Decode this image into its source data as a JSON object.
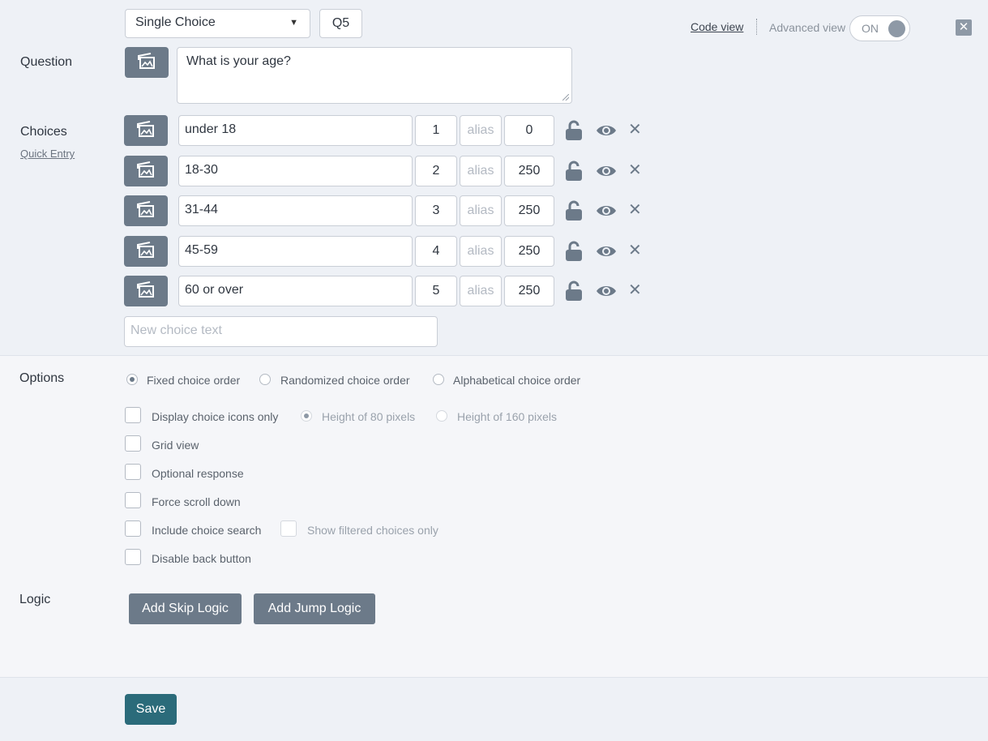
{
  "header": {
    "question_type": "Single Choice",
    "question_id": "Q5",
    "code_view_label": "Code view",
    "advanced_view_label": "Advanced view",
    "advanced_toggle": "ON"
  },
  "labels": {
    "question": "Question",
    "choices": "Choices",
    "quick_entry": "Quick Entry",
    "options": "Options",
    "logic": "Logic"
  },
  "question": {
    "text": "What is your age?"
  },
  "choices": [
    {
      "text": "under 18",
      "number": "1",
      "alias_placeholder": "alias",
      "score": "0"
    },
    {
      "text": "18-30",
      "number": "2",
      "alias_placeholder": "alias",
      "score": "250"
    },
    {
      "text": "31-44",
      "number": "3",
      "alias_placeholder": "alias",
      "score": "250"
    },
    {
      "text": "45-59",
      "number": "4",
      "alias_placeholder": "alias",
      "score": "250"
    },
    {
      "text": "60 or over",
      "number": "5",
      "alias_placeholder": "alias",
      "score": "250"
    }
  ],
  "new_choice_placeholder": "New choice text",
  "options": {
    "order": [
      {
        "label": "Fixed choice order",
        "selected": true
      },
      {
        "label": "Randomized choice order",
        "selected": false
      },
      {
        "label": "Alphabetical choice order",
        "selected": false
      }
    ],
    "display_icons_only": "Display choice icons only",
    "height_80": "Height of 80 pixels",
    "height_160": "Height of 160 pixels",
    "grid_view": "Grid view",
    "optional_response": "Optional response",
    "force_scroll": "Force scroll down",
    "include_search": "Include choice search",
    "show_filtered": "Show filtered choices only",
    "disable_back": "Disable back button"
  },
  "logic": {
    "skip_label": "Add Skip Logic",
    "jump_label": "Add Jump Logic"
  },
  "footer": {
    "save_label": "Save"
  },
  "colors": {
    "accent": "#2b6b7a",
    "button_gray": "#6c7a89",
    "background": "#eef1f6"
  }
}
